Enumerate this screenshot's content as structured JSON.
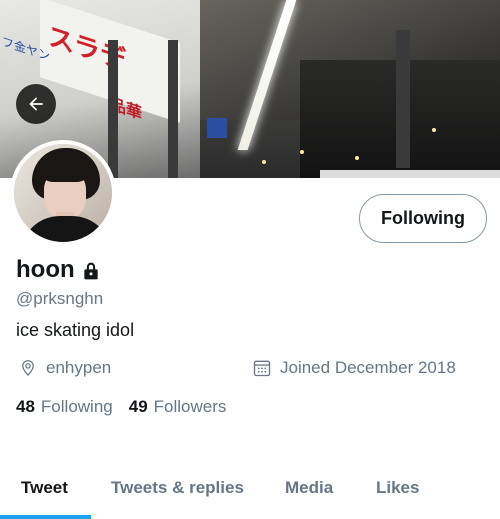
{
  "profile": {
    "name": "hoon",
    "handle": "@prksnghn",
    "bio": "ice skating idol",
    "location": "enhypen",
    "joined": "Joined December 2018",
    "following_count": "48",
    "following_label": "Following",
    "followers_count": "49",
    "followers_label": "Followers",
    "protected": true
  },
  "header": {
    "back_icon": "back-arrow-icon",
    "follow_button_label": "Following"
  },
  "tabs": [
    {
      "label": "Tweet",
      "active": true
    },
    {
      "label": "Tweets & replies",
      "active": false
    },
    {
      "label": "Media",
      "active": false
    },
    {
      "label": "Likes",
      "active": false
    }
  ],
  "colors": {
    "accent": "#1da1f2",
    "secondary_text": "#657786",
    "primary_text": "#14171a"
  }
}
